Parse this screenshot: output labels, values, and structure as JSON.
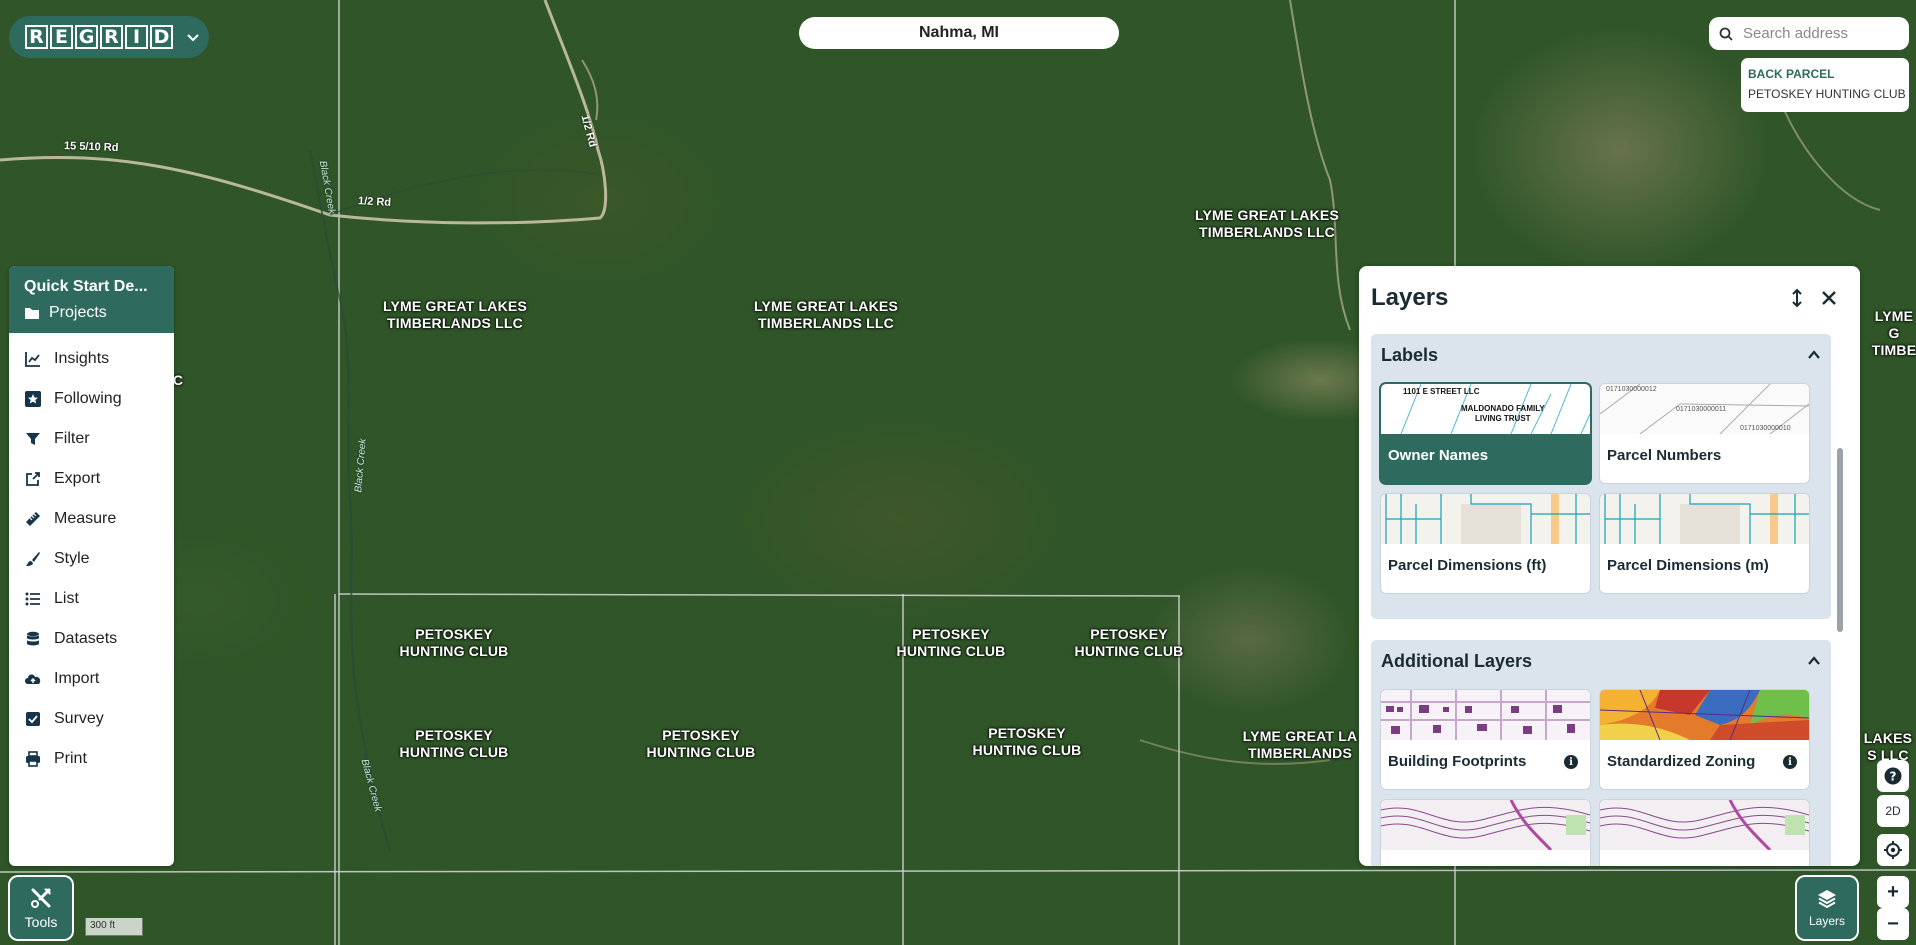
{
  "location": "Nahma, MI",
  "logo": {
    "letters": [
      "R",
      "E",
      "G",
      "R",
      "I",
      "D"
    ]
  },
  "search": {
    "placeholder": "Search address"
  },
  "tooltip": {
    "title": "BACK PARCEL",
    "owner": "PETOSKEY HUNTING CLUB"
  },
  "menu": {
    "title": "Quick Start De...",
    "projects": "Projects",
    "items": [
      {
        "label": "Insights",
        "icon": "chart-line-icon"
      },
      {
        "label": "Following",
        "icon": "star-icon"
      },
      {
        "label": "Filter",
        "icon": "filter-icon"
      },
      {
        "label": "Export",
        "icon": "export-icon"
      },
      {
        "label": "Measure",
        "icon": "measure-icon"
      },
      {
        "label": "Style",
        "icon": "brush-icon"
      },
      {
        "label": "List",
        "icon": "list-icon"
      },
      {
        "label": "Datasets",
        "icon": "database-icon"
      },
      {
        "label": "Import",
        "icon": "cloud-upload-icon"
      },
      {
        "label": "Survey",
        "icon": "checkbox-icon"
      },
      {
        "label": "Print",
        "icon": "printer-icon"
      }
    ]
  },
  "tools_label": "Tools",
  "scale_label": "300 ft",
  "layers": {
    "title": "Layers",
    "labels_section": {
      "title": "Labels",
      "cards": [
        "Owner Names",
        "Parcel Numbers",
        "Parcel Dimensions (ft)",
        "Parcel Dimensions (m)"
      ],
      "owner_thumb": [
        "1101 E STREET LLC",
        "MALDONADO FAMILY",
        "LIVING TRUST"
      ],
      "parcel_thumb": [
        "0171030000012",
        "0171030000011",
        "0171030000010"
      ]
    },
    "additional_section": {
      "title": "Additional Layers",
      "cards": [
        "Building Footprints",
        "Standardized Zoning"
      ]
    }
  },
  "controls": {
    "help": "?",
    "view_mode": "2D",
    "zoom_in": "+",
    "zoom_out": "−"
  },
  "layers_button": "Layers",
  "map_labels": {
    "owners": [
      "LYME GREAT LAKES\nTIMBERLANDS LLC",
      "LYME GREAT LAKES\nTIMBERLANDS LLC",
      "LYME GREAT LAKES\nTIMBERLANDS LLC",
      "PETOSKEY\nHUNTING CLUB",
      "PETOSKEY\nHUNTING CLUB",
      "PETOSKEY\nHUNTING CLUB",
      "PETOSKEY\nHUNTING CLUB",
      "PETOSKEY\nHUNTING CLUB",
      "PETOSKEY\nHUNTING CLUB",
      "LYME GREAT LA\nTIMBERLANDS",
      "LYME G\nTIMBE",
      "LAKES\nS LLC",
      "C"
    ],
    "roads": [
      "15 5/10 Rd",
      "1/2 Rd",
      "1/2 Rd"
    ],
    "creeks": [
      "Black Creek",
      "Black Creek",
      "Black Creek"
    ]
  }
}
